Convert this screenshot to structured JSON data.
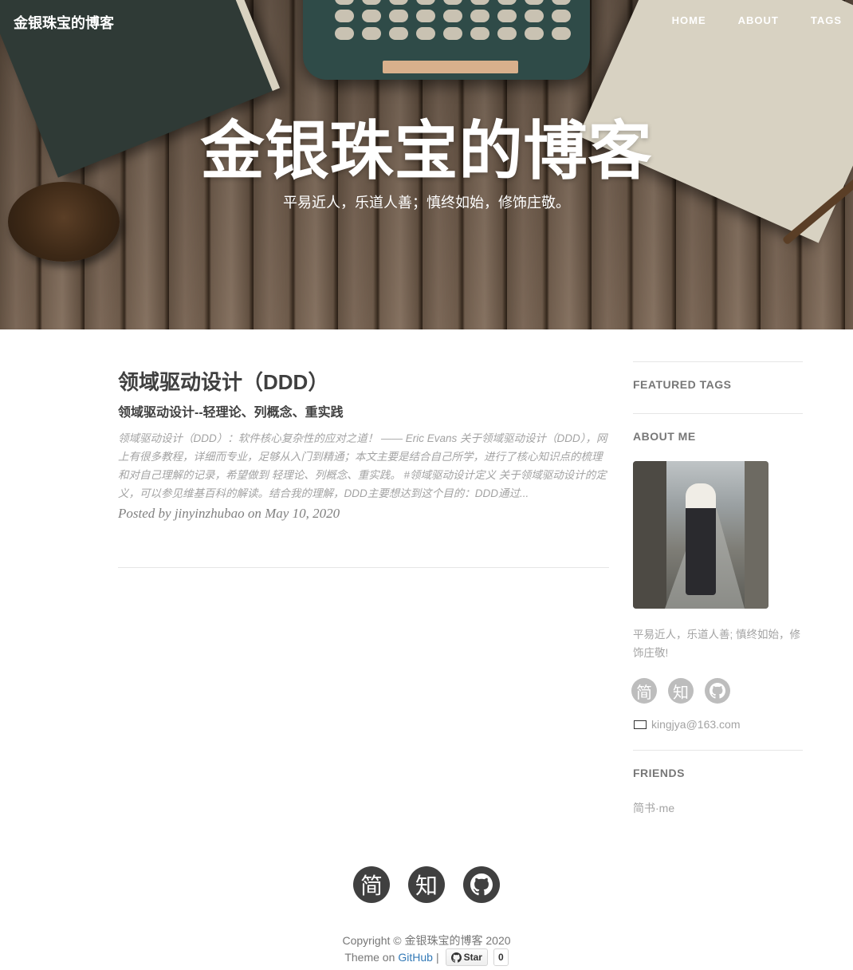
{
  "nav": {
    "brand": "金银珠宝的博客",
    "links": [
      "HOME",
      "ABOUT",
      "TAGS"
    ]
  },
  "hero": {
    "title": "金银珠宝的博客",
    "subtitle": "平易近人，乐道人善；慎终如始，修饰庄敬。"
  },
  "post": {
    "title": "领域驱动设计（DDD）",
    "subtitle": "领域驱动设计--轻理论、列概念、重实践",
    "excerpt": "领域驱动设计（DDD）：软件核心复杂性的应对之道！ —— Eric Evans 关于领域驱动设计（DDD），网上有很多教程，详细而专业，足够从入门到精通；本文主要是结合自己所学，进行了核心知识点的梳理和对自己理解的记录，希望做到 轻理论、列概念、重实践。 #领域驱动设计定义 关于领域驱动设计的定义，可以参见维基百科的解读。结合我的理解，DDD主要想达到这个目的：DDD通过...",
    "meta": "Posted by jinyinzhubao on May 10, 2020"
  },
  "sidebar": {
    "featured_tags_heading": "FEATURED TAGS",
    "about_heading": "ABOUT ME",
    "about_text": "平易近人，乐道人善; 慎终如始，修饰庄敬!",
    "social": [
      "简",
      "知",
      "github-icon"
    ],
    "email": "kingjya@163.com",
    "friends_heading": "FRIENDS",
    "friends_link": "简书·me"
  },
  "footer": {
    "icons": [
      "简",
      "知",
      "github-icon"
    ],
    "copyright": "Copyright © 金银珠宝的博客 2020",
    "theme_prefix": "Theme on",
    "theme_link": "GitHub",
    "separator": "|",
    "star_label": "Star",
    "star_count": "0"
  }
}
